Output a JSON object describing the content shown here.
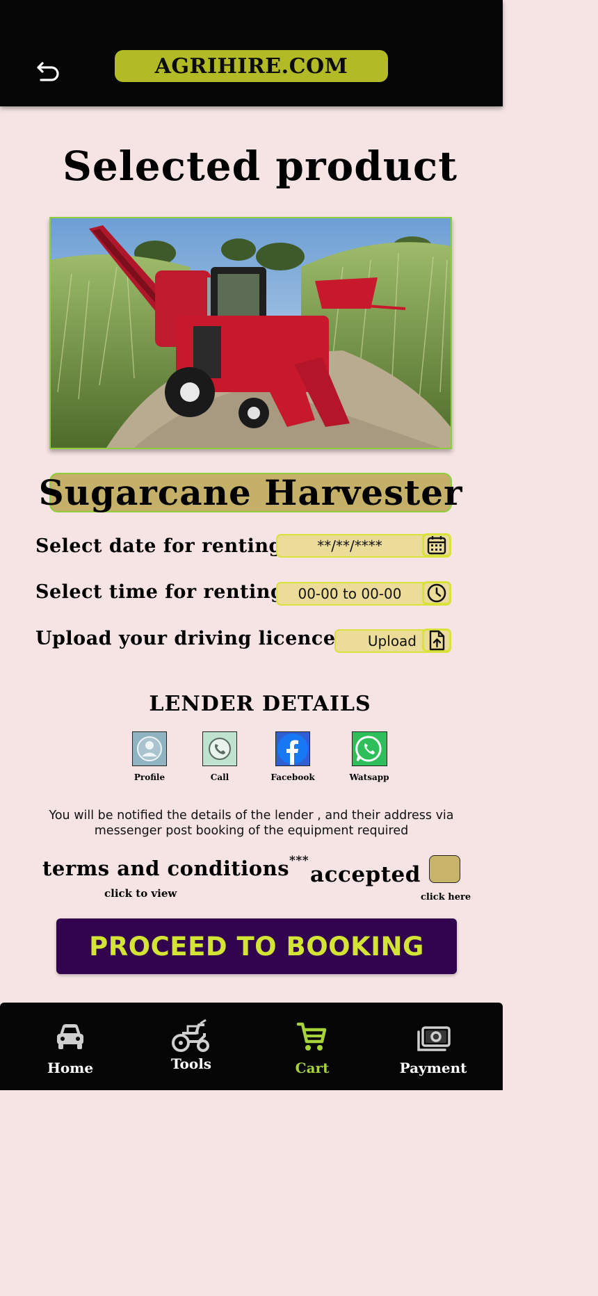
{
  "header": {
    "brand": "AGRIHIRE.COM",
    "back_icon": "undo-arrow-icon"
  },
  "page": {
    "title": "Selected product"
  },
  "product": {
    "name": "Sugarcane Harvester"
  },
  "form": {
    "date_label": "Select date for renting",
    "date_value": "**/**/****",
    "date_icon": "calendar-icon",
    "time_label": "Select time for renting",
    "time_value": "00-00 to 00-00",
    "time_icon": "clock-icon",
    "licence_label": "Upload your driving licence",
    "upload_label": "Upload",
    "upload_icon": "file-upload-icon"
  },
  "lender": {
    "title": "LENDER DETAILS",
    "contacts": [
      {
        "label": "Profile",
        "icon": "profile-icon"
      },
      {
        "label": "Call",
        "icon": "phone-icon"
      },
      {
        "label": "Facebook",
        "icon": "facebook-icon"
      },
      {
        "label": "Watsapp",
        "icon": "whatsapp-icon"
      }
    ],
    "notice": "You will be notified the details of the lender , and their address via messenger post booking of the equipment required"
  },
  "terms": {
    "text": "terms and conditions",
    "marker": "***",
    "click_to_view": "click to view",
    "accepted": "accepted",
    "click_here": "click here"
  },
  "actions": {
    "proceed": "PROCEED TO BOOKING"
  },
  "nav": {
    "items": [
      {
        "label": "Home",
        "icon": "car-icon"
      },
      {
        "label": "Tools",
        "icon": "tractor-icon"
      },
      {
        "label": "Cart",
        "icon": "cart-icon",
        "active": true
      },
      {
        "label": "Payment",
        "icon": "money-icon"
      }
    ]
  },
  "colors": {
    "background": "#f6e4e4",
    "brand": "#b2bb26",
    "accent_green": "#a6d23a",
    "proceed_bg": "#32044f",
    "proceed_text": "#d3e435",
    "product_name_bg": "#c5b06a"
  }
}
